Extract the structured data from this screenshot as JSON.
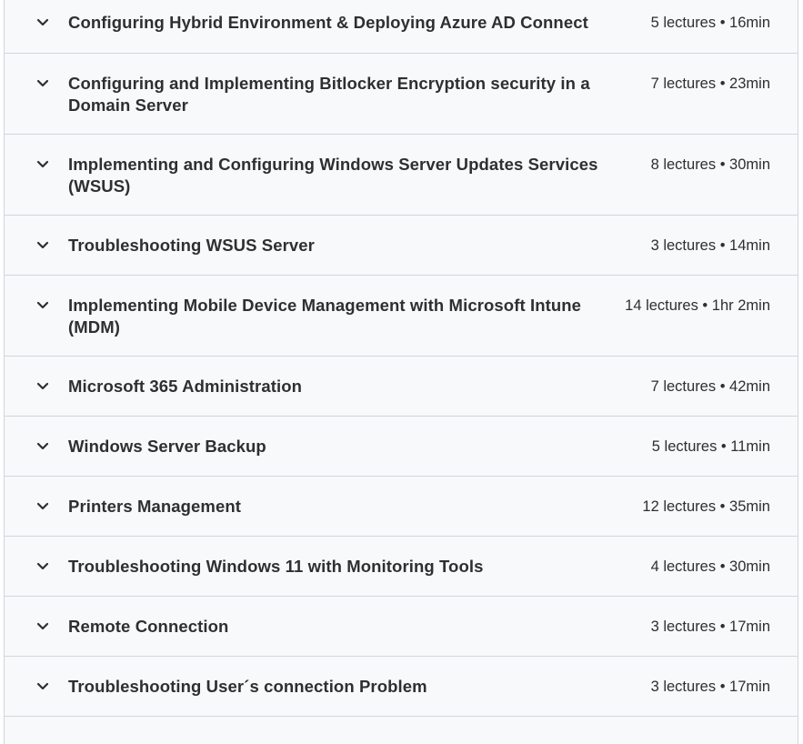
{
  "sections": [
    {
      "title": "Configuring Hybrid Environment & Deploying Azure AD Connect",
      "meta": "5 lectures • 16min"
    },
    {
      "title": "Configuring and Implementing Bitlocker Encryption security in a Domain Server",
      "meta": "7 lectures • 23min"
    },
    {
      "title": "Implementing and Configuring Windows Server Updates Services (WSUS)",
      "meta": "8 lectures • 30min"
    },
    {
      "title": "Troubleshooting WSUS Server",
      "meta": "3 lectures • 14min"
    },
    {
      "title": "Implementing Mobile Device Management with Microsoft Intune (MDM)",
      "meta": "14 lectures • 1hr 2min"
    },
    {
      "title": "Microsoft 365 Administration",
      "meta": "7 lectures • 42min"
    },
    {
      "title": "Windows Server Backup",
      "meta": "5 lectures • 11min"
    },
    {
      "title": "Printers Management",
      "meta": "12 lectures • 35min"
    },
    {
      "title": "Troubleshooting Windows 11 with Monitoring Tools",
      "meta": "4 lectures • 30min"
    },
    {
      "title": "Remote Connection",
      "meta": "3 lectures • 17min"
    },
    {
      "title": "Troubleshooting User´s connection Problem",
      "meta": "3 lectures • 17min"
    }
  ],
  "icons": {
    "expand": "chevron-down-icon"
  },
  "colors": {
    "row_bg": "#f7f9fa",
    "border": "#d1d7dc",
    "text": "#2d2f31"
  }
}
